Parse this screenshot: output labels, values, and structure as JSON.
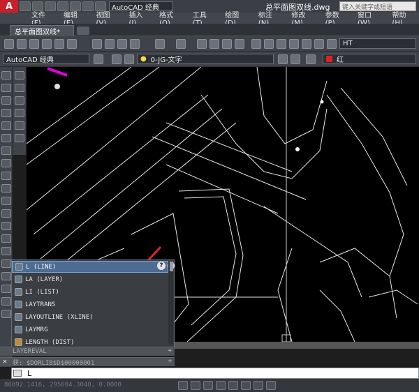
{
  "titlebar": {
    "logo": "A",
    "workspace": "AutoCAD 经典",
    "document_title": "总平面图双线.dwg",
    "search_placeholder": "键入关键字或短语"
  },
  "menu": [
    "文件(F)",
    "编辑(E)",
    "视图(V)",
    "插入(I)",
    "格式(O)",
    "工具(T)",
    "绘图(D)",
    "标注(N)",
    "修改(M)",
    "参数(P)",
    "窗口(W)",
    "帮助(H)"
  ],
  "tabs": {
    "active": "总平面图双线*"
  },
  "toolbar1": {
    "textstyle": "HT"
  },
  "toolbar2": {
    "workspace": "AutoCAD 经典",
    "layer": "0-JG-文字",
    "color": "红",
    "color_hex": "#e02020"
  },
  "autocomplete": {
    "items": [
      {
        "label": "L (LINE)",
        "icon": "line-icon",
        "selected": true
      },
      {
        "label": "LA (LAYER)",
        "icon": "layer-icon"
      },
      {
        "label": "LI (LIST)",
        "icon": "list-icon"
      },
      {
        "label": "LAYTRANS",
        "icon": "laytrans-icon"
      },
      {
        "label": "LAYOUTLINE (XLINE)",
        "icon": "xline-icon"
      },
      {
        "label": "LAYMRG",
        "icon": "laymrg-icon"
      },
      {
        "label": "LENGTH (DIST)",
        "icon": "dist-icon"
      }
    ]
  },
  "history": [
    {
      "text": "LAYEREVAL"
    },
    {
      "text": "获: $DORLIB$D$00000001"
    }
  ],
  "command": {
    "input": "L"
  },
  "status": {
    "coords": "86892.1416, 295604.3040, 0.0000"
  }
}
